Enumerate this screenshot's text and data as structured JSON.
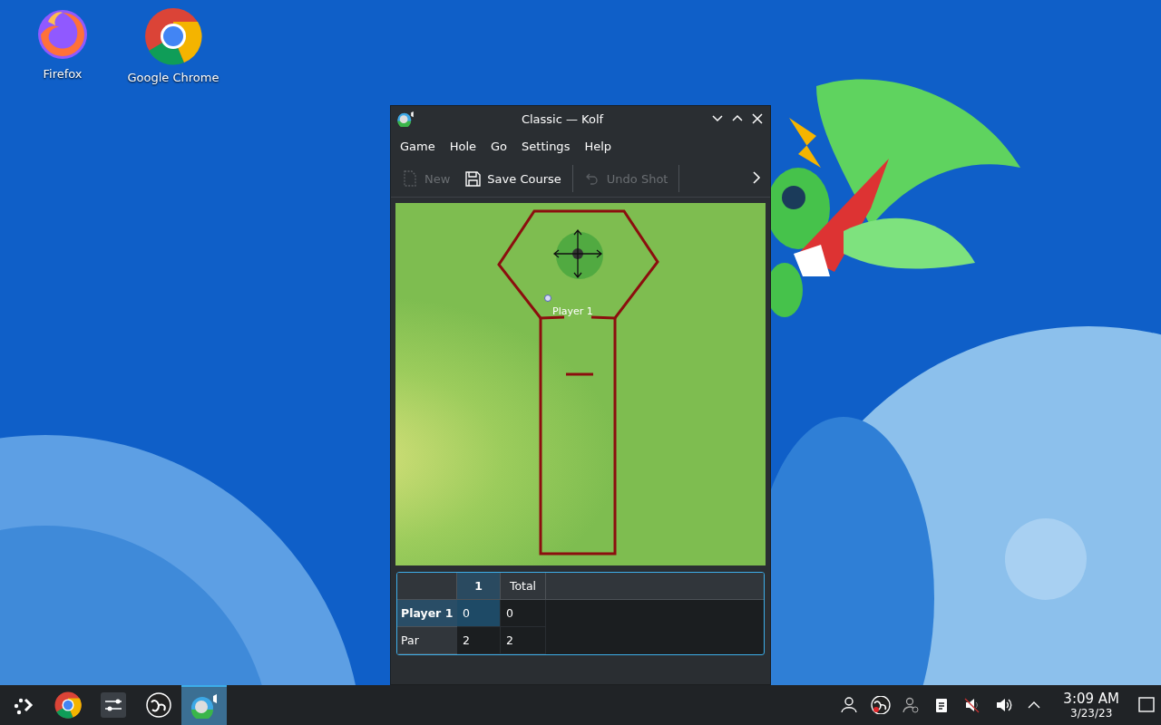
{
  "desktop_icons": [
    {
      "label": "Firefox",
      "kind": "firefox"
    },
    {
      "label": "Google Chrome",
      "kind": "chrome"
    }
  ],
  "window": {
    "title": "Classic — Kolf",
    "menu": [
      "Game",
      "Hole",
      "Go",
      "Settings",
      "Help"
    ],
    "toolbar": [
      {
        "label": "New",
        "kind": "new",
        "disabled": true
      },
      {
        "label": "Save Course",
        "kind": "save",
        "disabled": false
      },
      {
        "label": "Undo Shot",
        "kind": "undo",
        "disabled": true
      }
    ],
    "course": {
      "player_label": "Player 1"
    },
    "scoreboard": {
      "columns": [
        {
          "label": "1",
          "selected": true
        },
        {
          "label": "Total",
          "selected": false
        }
      ],
      "rows": [
        {
          "name": "Player 1",
          "selected": true,
          "cells": [
            {
              "value": "0",
              "selected": true
            },
            {
              "value": "0",
              "selected": false
            }
          ]
        },
        {
          "name": "Par",
          "selected": false,
          "cells": [
            {
              "value": "2",
              "selected": false
            },
            {
              "value": "2",
              "selected": false
            }
          ]
        }
      ]
    }
  },
  "taskbar": {
    "items": [
      {
        "kind": "launcher",
        "active": false
      },
      {
        "kind": "chrome",
        "active": false
      },
      {
        "kind": "mixer",
        "active": false
      },
      {
        "kind": "obs",
        "active": false
      },
      {
        "kind": "kolf",
        "active": true
      }
    ],
    "clock": {
      "time": "3:09 AM",
      "date": "3/23/23"
    }
  }
}
